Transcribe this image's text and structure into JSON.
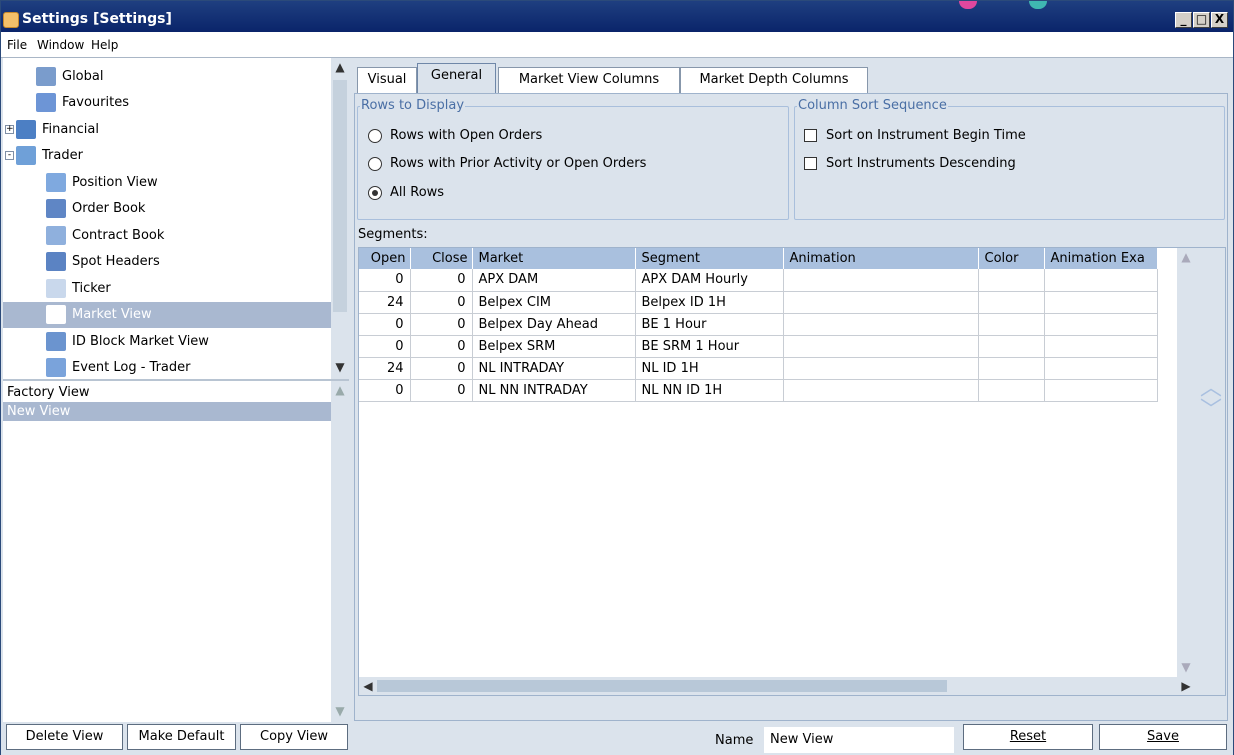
{
  "window": {
    "title": "Settings [Settings]",
    "buttons": [
      "_",
      "□",
      "X"
    ],
    "accent_color": "#0a246a"
  },
  "menu": {
    "file": "File",
    "window": "Window",
    "help": "Help"
  },
  "tree": {
    "items": [
      {
        "label": "Global",
        "icon": "globe-icon",
        "indent": 0,
        "expander": ""
      },
      {
        "label": "Favourites",
        "icon": "star-icon",
        "indent": 0,
        "expander": ""
      },
      {
        "label": "Financial",
        "icon": "scales-icon",
        "indent": 0,
        "expander": "+"
      },
      {
        "label": "Trader",
        "icon": "chart-icon",
        "indent": 0,
        "expander": "-"
      },
      {
        "label": "Position View",
        "icon": "position-icon",
        "indent": 1,
        "expander": ""
      },
      {
        "label": "Order Book",
        "icon": "book-icon",
        "indent": 1,
        "expander": ""
      },
      {
        "label": "Contract Book",
        "icon": "contract-icon",
        "indent": 1,
        "expander": ""
      },
      {
        "label": "Spot Headers",
        "icon": "spot-icon",
        "indent": 1,
        "expander": ""
      },
      {
        "label": "Ticker",
        "icon": "ticker-icon",
        "indent": 1,
        "expander": ""
      },
      {
        "label": "Market View",
        "icon": "market-icon",
        "indent": 1,
        "expander": "",
        "selected": true
      },
      {
        "label": "ID Block Market View",
        "icon": "block-icon",
        "indent": 1,
        "expander": ""
      },
      {
        "label": "Event Log - Trader",
        "icon": "log-icon",
        "indent": 1,
        "expander": ""
      }
    ]
  },
  "views": {
    "items": [
      {
        "label": "Factory View",
        "selected": false
      },
      {
        "label": "New View",
        "selected": true
      }
    ]
  },
  "tabs": [
    {
      "label": "Visual",
      "active": false
    },
    {
      "label": "General",
      "active": true
    },
    {
      "label": "Market View Columns",
      "active": false
    },
    {
      "label": "Market Depth Columns",
      "active": false
    }
  ],
  "rows_to_display": {
    "title": "Rows to Display",
    "options": [
      {
        "label": "Rows with Open Orders",
        "selected": false
      },
      {
        "label": "Rows with Prior Activity or Open Orders",
        "selected": false
      },
      {
        "label": "All Rows",
        "selected": true
      }
    ]
  },
  "column_sort": {
    "title": "Column Sort Sequence",
    "options": [
      {
        "label": "Sort on Instrument Begin Time",
        "checked": false
      },
      {
        "label": "Sort Instruments Descending",
        "checked": false
      }
    ]
  },
  "segments": {
    "label": "Segments:",
    "columns": [
      "Open",
      "Close",
      "Market",
      "Segment",
      "Animation",
      "Color",
      "Animation Exa"
    ],
    "rows": [
      [
        "0",
        "0",
        "APX DAM",
        "APX DAM Hourly",
        "",
        "",
        ""
      ],
      [
        "24",
        "0",
        "Belpex CIM",
        "Belpex ID 1H",
        "",
        "",
        ""
      ],
      [
        "0",
        "0",
        "Belpex Day Ahead",
        "BE 1 Hour",
        "",
        "",
        ""
      ],
      [
        "0",
        "0",
        "Belpex SRM",
        "BE SRM 1 Hour",
        "",
        "",
        ""
      ],
      [
        "24",
        "0",
        "NL INTRADAY",
        "NL ID 1H",
        "",
        "",
        ""
      ],
      [
        "0",
        "0",
        "NL NN INTRADAY",
        "NL NN ID 1H",
        "",
        "",
        ""
      ]
    ]
  },
  "footer": {
    "delete_view": "Delete View",
    "make_default": "Make Default",
    "copy_view": "Copy View",
    "name_label": "Name",
    "name_value": "New View",
    "reset": "Reset",
    "save": "Save"
  }
}
